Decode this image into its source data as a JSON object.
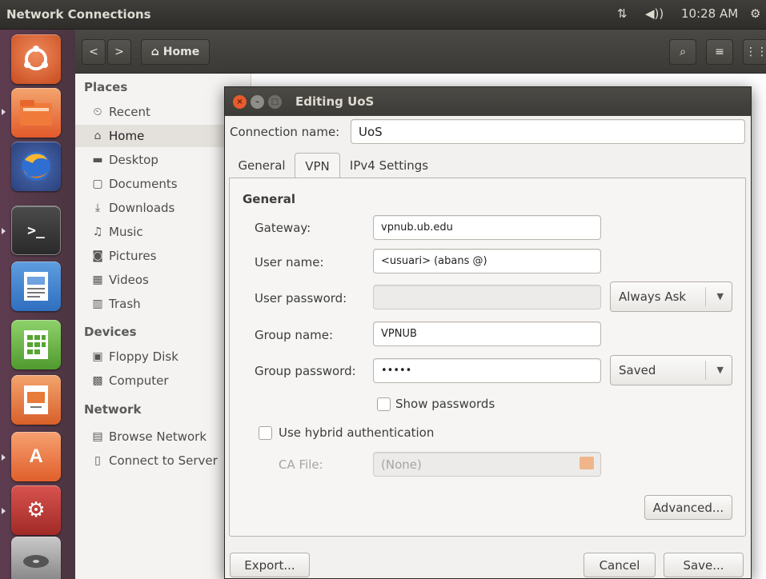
{
  "top_panel": {
    "app_title": "Network Connections",
    "network_icon": "network-arrows-icon",
    "volume_icon": "volume-icon",
    "clock": "10:28 AM",
    "power_icon": "power-gear-icon"
  },
  "launcher": {
    "items": [
      "ubuntu-dash-icon",
      "files-icon",
      "firefox-icon",
      "terminal-icon",
      "writer-icon",
      "calc-icon",
      "impress-icon",
      "software-center-icon",
      "settings-icon",
      "disk-icon"
    ]
  },
  "nautilus": {
    "back_glyph": "<",
    "forward_glyph": ">",
    "path_label": "Home",
    "search_glyph": "🔍",
    "menu_glyph": "≡",
    "grid_glyph": "⋮⋮",
    "sidebar": {
      "places_heading": "Places",
      "places": [
        {
          "label": "Recent",
          "icon": "clock-icon",
          "glyph": "⏲"
        },
        {
          "label": "Home",
          "icon": "home-icon",
          "glyph": "⌂"
        },
        {
          "label": "Desktop",
          "icon": "folder-icon",
          "glyph": "▬"
        },
        {
          "label": "Documents",
          "icon": "document-icon",
          "glyph": "▢"
        },
        {
          "label": "Downloads",
          "icon": "download-icon",
          "glyph": "⤓"
        },
        {
          "label": "Music",
          "icon": "music-icon",
          "glyph": "♫"
        },
        {
          "label": "Pictures",
          "icon": "camera-icon",
          "glyph": "◙"
        },
        {
          "label": "Videos",
          "icon": "film-icon",
          "glyph": "▦"
        },
        {
          "label": "Trash",
          "icon": "trash-icon",
          "glyph": "🗑"
        }
      ],
      "devices_heading": "Devices",
      "devices": [
        {
          "label": "Floppy Disk",
          "icon": "floppy-icon",
          "glyph": "▣"
        },
        {
          "label": "Computer",
          "icon": "computer-icon",
          "glyph": "▩"
        }
      ],
      "network_heading": "Network",
      "network": [
        {
          "label": "Browse Network",
          "icon": "network-icon",
          "glyph": "▤"
        },
        {
          "label": "Connect to Server",
          "icon": "server-icon",
          "glyph": "▯"
        }
      ]
    }
  },
  "dialog": {
    "title": "Editing UoS",
    "connection_name_label": "Connection name:",
    "connection_name_value": "UoS",
    "tabs": [
      "General",
      "VPN",
      "IPv4 Settings"
    ],
    "section_heading": "General",
    "gateway_label": "Gateway:",
    "gateway_value": "vpnub.ub.edu",
    "username_label": "User name:",
    "username_value": "<usuari> (abans @)",
    "user_password_label": "User password:",
    "user_password_value": "",
    "user_password_mode": "Always Ask",
    "group_name_label": "Group name:",
    "group_name_value": "VPNUB",
    "group_password_label": "Group password:",
    "group_password_value": "•••••",
    "group_password_mode": "Saved",
    "show_passwords_label": "Show passwords",
    "hybrid_auth_label": "Use hybrid authentication",
    "ca_file_label": "CA File:",
    "ca_file_value": "(None)",
    "advanced_button": "Advanced...",
    "export_button": "Export...",
    "cancel_button": "Cancel",
    "save_button": "Save...",
    "close_glyph": "×",
    "min_glyph": "–",
    "max_glyph": "□"
  }
}
